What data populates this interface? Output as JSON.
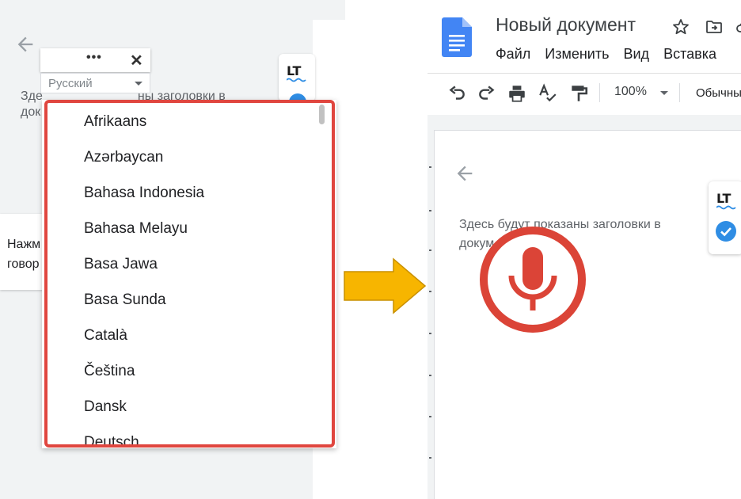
{
  "left": {
    "background_text_lines": [
      "Зде",
      "док"
    ],
    "background_text_tail": "ны заголовки в",
    "popup_text_lines": [
      "Нажм",
      "говор"
    ],
    "voice_toolbar": {
      "more_label": "•••",
      "close_label": "✕"
    },
    "language_select": {
      "selected": "Русский"
    },
    "language_options": [
      "Afrikaans",
      "Azərbaycan",
      "Bahasa Indonesia",
      "Bahasa Melayu",
      "Basa Jawa",
      "Basa Sunda",
      "Català",
      "Čeština",
      "Dansk",
      "Deutsch"
    ],
    "languagetool": {
      "logo": "LT",
      "icon": "languagetool-icon"
    }
  },
  "arrow": {
    "color": "#f7b500",
    "icon": "right-arrow-icon"
  },
  "right": {
    "doc_title": "Новый документ",
    "menu": [
      "Файл",
      "Изменить",
      "Вид",
      "Вставка"
    ],
    "toolbar": {
      "zoom": "100%",
      "style": "Обычный"
    },
    "outline_text_lines": [
      "Здесь будут показаны заголовки в",
      "докум"
    ],
    "mic_color": "#db4437",
    "languagetool": {
      "logo": "LT",
      "check_color": "#2f8de4"
    }
  },
  "colors": {
    "highlight": "#e0463f",
    "docs_blue": "#4285f4"
  }
}
